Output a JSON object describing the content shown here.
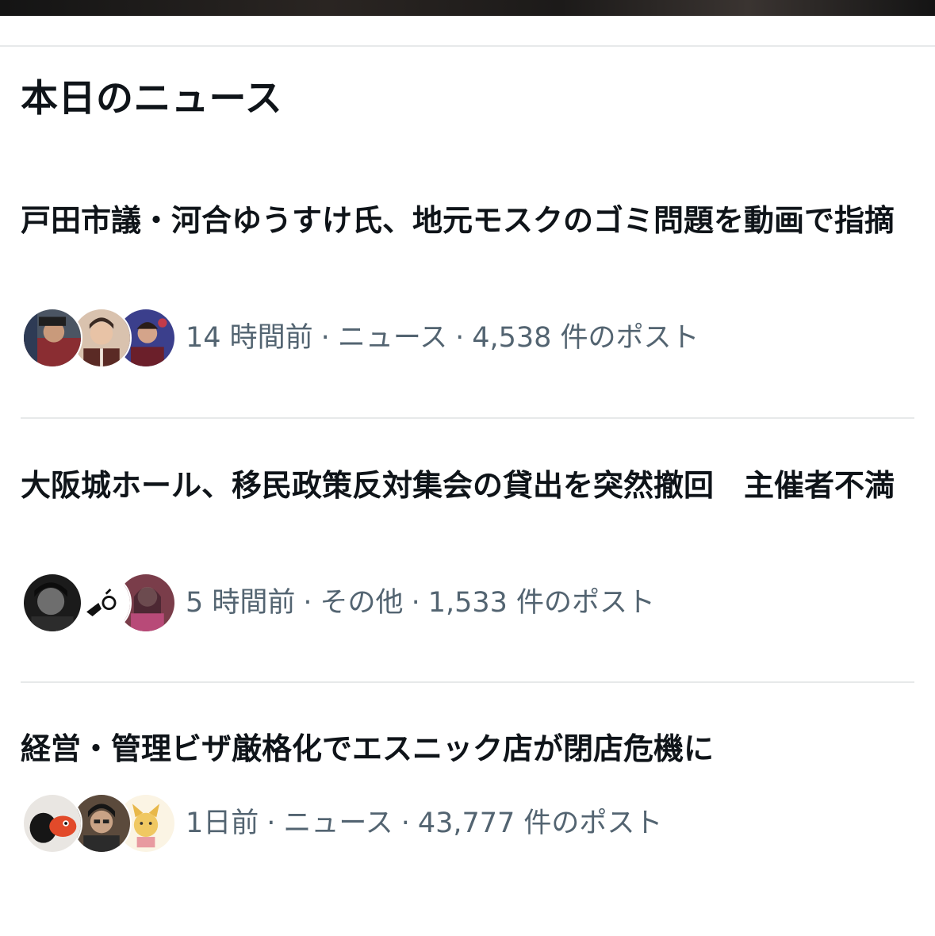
{
  "section": {
    "title": "本日のニュース"
  },
  "news": [
    {
      "headline": "戸田市議・河合ゆうすけ氏、地元モスクのゴミ問題を動画で指摘",
      "time": "14 時間前",
      "category": "ニュース",
      "posts": "4,538 件のポスト",
      "separator": "·"
    },
    {
      "headline": "大阪城ホール、移民政策反対集会の貸出を突然撤回　主催者不満",
      "time": "5 時間前",
      "category": "その他",
      "posts": "1,533 件のポスト",
      "separator": "·"
    },
    {
      "headline": "経営・管理ビザ厳格化でエスニック店が閉店危機に",
      "time": "1日前",
      "category": "ニュース",
      "posts": "43,777 件のポスト",
      "separator": "·"
    }
  ],
  "colors": {
    "text_primary": "#0f1419",
    "text_secondary": "#536471",
    "divider": "#e7e9ea"
  },
  "icons": [
    "avatar-photo"
  ]
}
